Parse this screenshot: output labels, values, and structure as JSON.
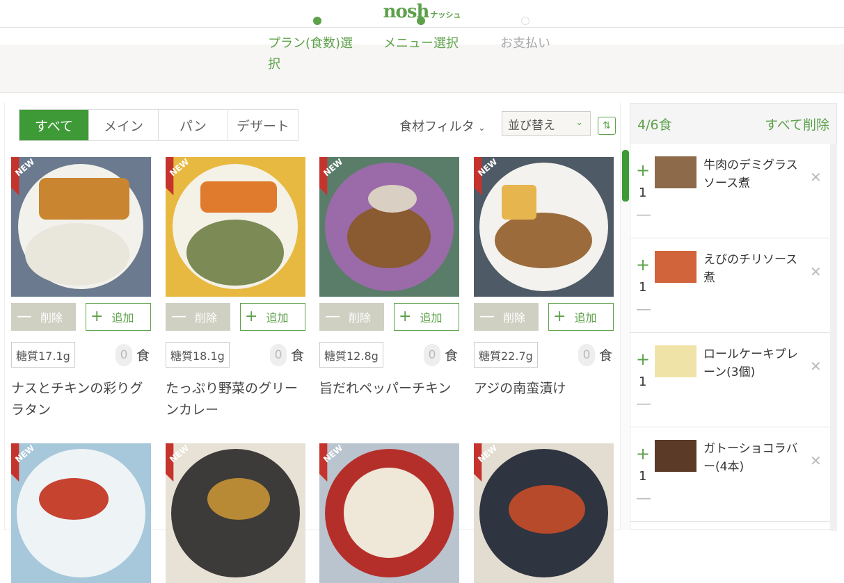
{
  "logo": {
    "text": "nosh",
    "sub": "ナッシュ"
  },
  "steps": [
    {
      "label": "プラン(食数)選",
      "label2": "択",
      "state": "done"
    },
    {
      "label": "メニュー選択",
      "state": "done"
    },
    {
      "label": "お支払い",
      "state": "todo"
    }
  ],
  "tabs": [
    "すべて",
    "メイン",
    "パン",
    "デザート"
  ],
  "filter_label": "食材フィルタ",
  "sort": {
    "selected": "並び替え"
  },
  "card_common": {
    "remove": "削除",
    "add": "追加",
    "meal_unit": "食",
    "new": "NEW"
  },
  "products": [
    {
      "name": "ナスとチキンの彩りグラタン",
      "carb": "糖質17.1g",
      "count": "0"
    },
    {
      "name": "たっぷり野菜のグリーンカレー",
      "carb": "糖質18.1g",
      "count": "0"
    },
    {
      "name": "旨だれペッパーチキン",
      "carb": "糖質12.8g",
      "count": "0"
    },
    {
      "name": "アジの南蛮漬け",
      "carb": "糖質22.7g",
      "count": "0"
    }
  ],
  "cart": {
    "count_label": "4/6食",
    "clear_label": "すべて削除",
    "items": [
      {
        "name": "牛肉のデミグラスソース煮",
        "qty": "1"
      },
      {
        "name": "えびのチリソース煮",
        "qty": "1"
      },
      {
        "name": "ロールケーキプレーン(3個)",
        "qty": "1"
      },
      {
        "name": "ガトーショコラバー(4本)",
        "qty": "1"
      }
    ]
  },
  "colors": {
    "brand": "#5da14a",
    "tab_active": "#3e9a36",
    "new_badge": "#c5342c"
  }
}
